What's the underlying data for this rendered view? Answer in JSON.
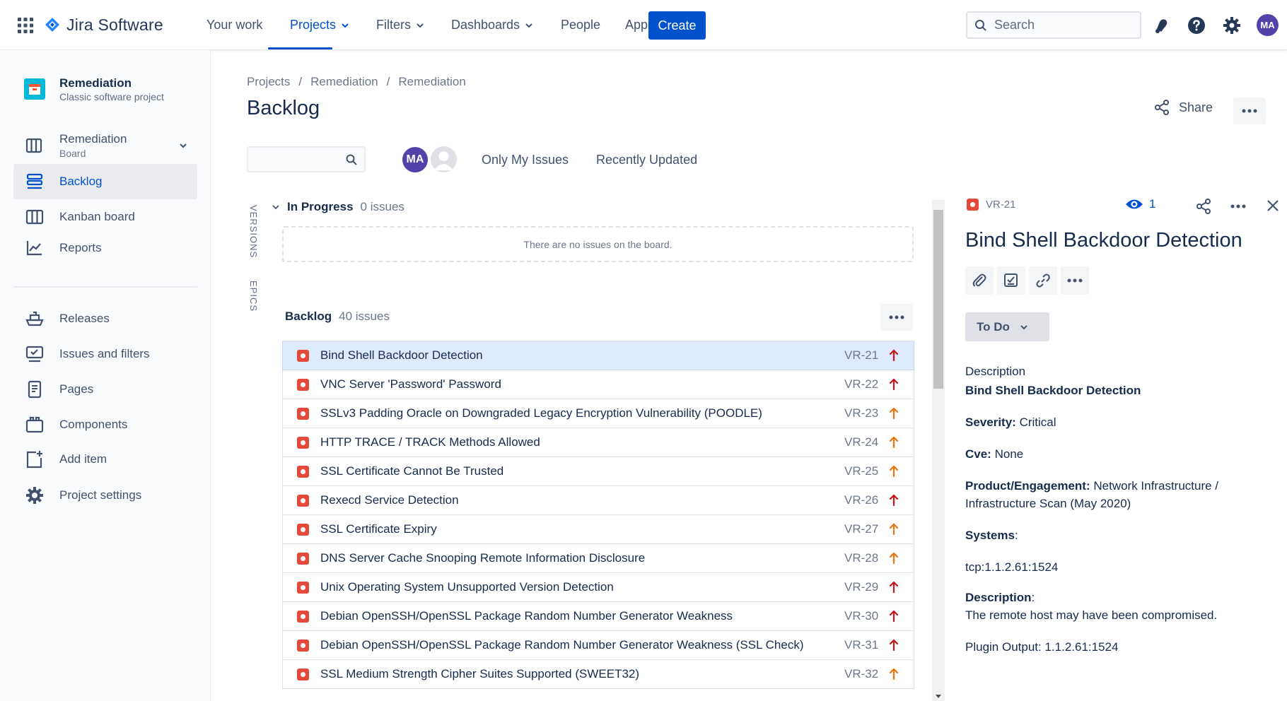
{
  "topnav": {
    "product": "Jira Software",
    "items": [
      {
        "label": "Your work"
      },
      {
        "label": "Projects"
      },
      {
        "label": "Filters"
      },
      {
        "label": "Dashboards"
      },
      {
        "label": "People"
      },
      {
        "label": "Apps"
      }
    ],
    "create_label": "Create",
    "search_placeholder": "Search",
    "user_initials": "MA"
  },
  "sidebar": {
    "project_name": "Remediation",
    "project_type": "Classic software project",
    "board_name": "Remediation",
    "board_sub": "Board",
    "items": [
      {
        "label": "Backlog"
      },
      {
        "label": "Kanban board"
      },
      {
        "label": "Reports"
      },
      {
        "label": "Releases"
      },
      {
        "label": "Issues and filters"
      },
      {
        "label": "Pages"
      },
      {
        "label": "Components"
      },
      {
        "label": "Add item"
      },
      {
        "label": "Project settings"
      }
    ]
  },
  "main": {
    "breadcrumb": [
      "Projects",
      "Remediation",
      "Remediation"
    ],
    "breadcrumb_sep": "/",
    "title": "Backlog",
    "share_label": "Share",
    "avatar_initials": "MA",
    "quick_filters": [
      "Only My Issues",
      "Recently Updated"
    ],
    "side_tabs": [
      "VERSIONS",
      "EPICS"
    ],
    "in_progress": {
      "title": "In Progress",
      "count": "0 issues",
      "empty": "There are no issues on the board."
    },
    "backlog": {
      "title": "Backlog",
      "count": "40 issues"
    },
    "issues": [
      {
        "summary": "Bind Shell Backdoor Detection",
        "key": "VR-21",
        "priority": "highest"
      },
      {
        "summary": "VNC Server 'Password' Password",
        "key": "VR-22",
        "priority": "highest"
      },
      {
        "summary": "SSLv3 Padding Oracle on Downgraded Legacy Encryption Vulnerability (POODLE)",
        "key": "VR-23",
        "priority": "high"
      },
      {
        "summary": "HTTP TRACE / TRACK Methods Allowed",
        "key": "VR-24",
        "priority": "high"
      },
      {
        "summary": "SSL Certificate Cannot Be Trusted",
        "key": "VR-25",
        "priority": "high"
      },
      {
        "summary": "Rexecd Service Detection",
        "key": "VR-26",
        "priority": "highest"
      },
      {
        "summary": "SSL Certificate Expiry",
        "key": "VR-27",
        "priority": "high"
      },
      {
        "summary": "DNS Server Cache Snooping Remote Information Disclosure",
        "key": "VR-28",
        "priority": "high"
      },
      {
        "summary": "Unix Operating System Unsupported Version Detection",
        "key": "VR-29",
        "priority": "highest"
      },
      {
        "summary": "Debian OpenSSH/OpenSSL Package Random Number Generator Weakness",
        "key": "VR-30",
        "priority": "highest"
      },
      {
        "summary": "Debian OpenSSH/OpenSSL Package Random Number Generator Weakness (SSL Check)",
        "key": "VR-31",
        "priority": "highest"
      },
      {
        "summary": "SSL Medium Strength Cipher Suites Supported (SWEET32)",
        "key": "VR-32",
        "priority": "high"
      }
    ]
  },
  "detail": {
    "key": "VR-21",
    "watchers": "1",
    "title": "Bind Shell Backdoor Detection",
    "status": "To Do",
    "description_label": "Description",
    "description_heading": "Bind Shell Backdoor Detection",
    "severity_label": "Severity:",
    "severity_value": "Critical",
    "cve_label": "Cve:",
    "cve_value": "None",
    "product_label": "Product/Engagement:",
    "product_value_1": "Network Infrastructure /",
    "product_value_2": "Infrastructure Scan (May 2020)",
    "systems_label": "Systems",
    "systems_colon": ":",
    "systems_value": "tcp:1.1.2.61:1524",
    "desc2_label": "Description",
    "desc2_colon": ":",
    "desc2_value": "The remote host may have been compromised.",
    "plugin_output": "Plugin Output: 1.1.2.61:1524"
  },
  "colors": {
    "brand": "#0052cc",
    "priority_highest": "#cd1317",
    "priority_high": "#e9730c",
    "bug": "#e5493a"
  }
}
